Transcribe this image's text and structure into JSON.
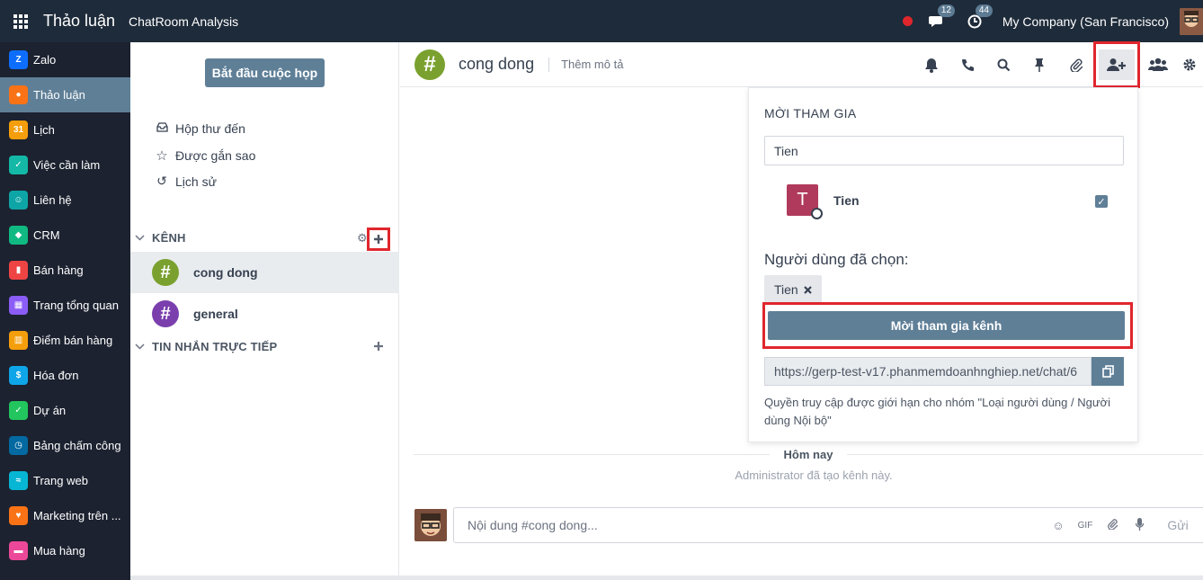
{
  "topbar": {
    "app_title": "Thảo luận",
    "menu_item": "ChatRoom Analysis",
    "messages_badge": "12",
    "activity_badge": "44",
    "company": "My Company (San Francisco)"
  },
  "app_sidebar": {
    "items": [
      {
        "label": "Zalo",
        "icon": "zalo-icon",
        "color": "#0d6efd",
        "active": false
      },
      {
        "label": "Thảo luận",
        "icon": "discuss-icon",
        "color": "#f97316",
        "active": true
      },
      {
        "label": "Lịch",
        "icon": "calendar-icon",
        "color": "#f59e0b",
        "active": false
      },
      {
        "label": "Việc cần làm",
        "icon": "todo-icon",
        "color": "#14b8a6",
        "active": false
      },
      {
        "label": "Liên hệ",
        "icon": "contacts-icon",
        "color": "#0ea5a6",
        "active": false
      },
      {
        "label": "CRM",
        "icon": "crm-icon",
        "color": "#10b981",
        "active": false
      },
      {
        "label": "Bán hàng",
        "icon": "sales-icon",
        "color": "#ef4444",
        "active": false
      },
      {
        "label": "Trang tổng quan",
        "icon": "dashboard-icon",
        "color": "#8b5cf6",
        "active": false
      },
      {
        "label": "Điểm bán hàng",
        "icon": "pos-icon",
        "color": "#f59e0b",
        "active": false
      },
      {
        "label": "Hóa đơn",
        "icon": "invoice-icon",
        "color": "#0ea5e9",
        "active": false
      },
      {
        "label": "Dự án",
        "icon": "project-icon",
        "color": "#22c55e",
        "active": false
      },
      {
        "label": "Bảng chấm công",
        "icon": "timesheet-icon",
        "color": "#0369a1",
        "active": false
      },
      {
        "label": "Trang web",
        "icon": "website-icon",
        "color": "#06b6d4",
        "active": false
      },
      {
        "label": "Marketing trên ...",
        "icon": "marketing-icon",
        "color": "#f97316",
        "active": false
      },
      {
        "label": "Mua hàng",
        "icon": "purchase-icon",
        "color": "#ec4899",
        "active": false
      }
    ]
  },
  "discuss_sidebar": {
    "start_meeting": "Bắt đầu cuộc họp",
    "mailboxes": [
      {
        "label": "Hộp thư đến",
        "icon": "inbox-icon",
        "glyph": "▭"
      },
      {
        "label": "Được gắn sao",
        "icon": "star-icon",
        "glyph": "☆"
      },
      {
        "label": "Lịch sử",
        "icon": "history-icon",
        "glyph": "↺"
      }
    ],
    "channels_header": "KÊNH",
    "channels": [
      {
        "name": "cong dong",
        "color": "#7aa12f",
        "active": true
      },
      {
        "name": "general",
        "color": "#7a3fad",
        "active": false
      }
    ],
    "direct_header": "TIN NHẮN TRỰC TIẾP"
  },
  "thread": {
    "title": "cong dong",
    "description_placeholder": "Thêm mô tả",
    "today_label": "Hôm nay",
    "notification": "Administrator đã tạo kênh này.",
    "composer_placeholder": "Nội dung #cong dong...",
    "send_label": "Gửi",
    "gif_label": "GIF"
  },
  "invite": {
    "title": "MỜI THAM GIA",
    "search_value": "Tien",
    "user_name": "Tien",
    "user_initial": "T",
    "selected_label": "Người dùng đã chọn:",
    "selected_tag": "Tien",
    "invite_button": "Mời tham gia kênh",
    "link": "https://gerp-test-v17.phanmemdoanhnghiep.net/chat/6",
    "note": "Quyền truy cập được giới hạn cho nhóm \"Loại người dùng / Người dùng Nội bộ\""
  }
}
